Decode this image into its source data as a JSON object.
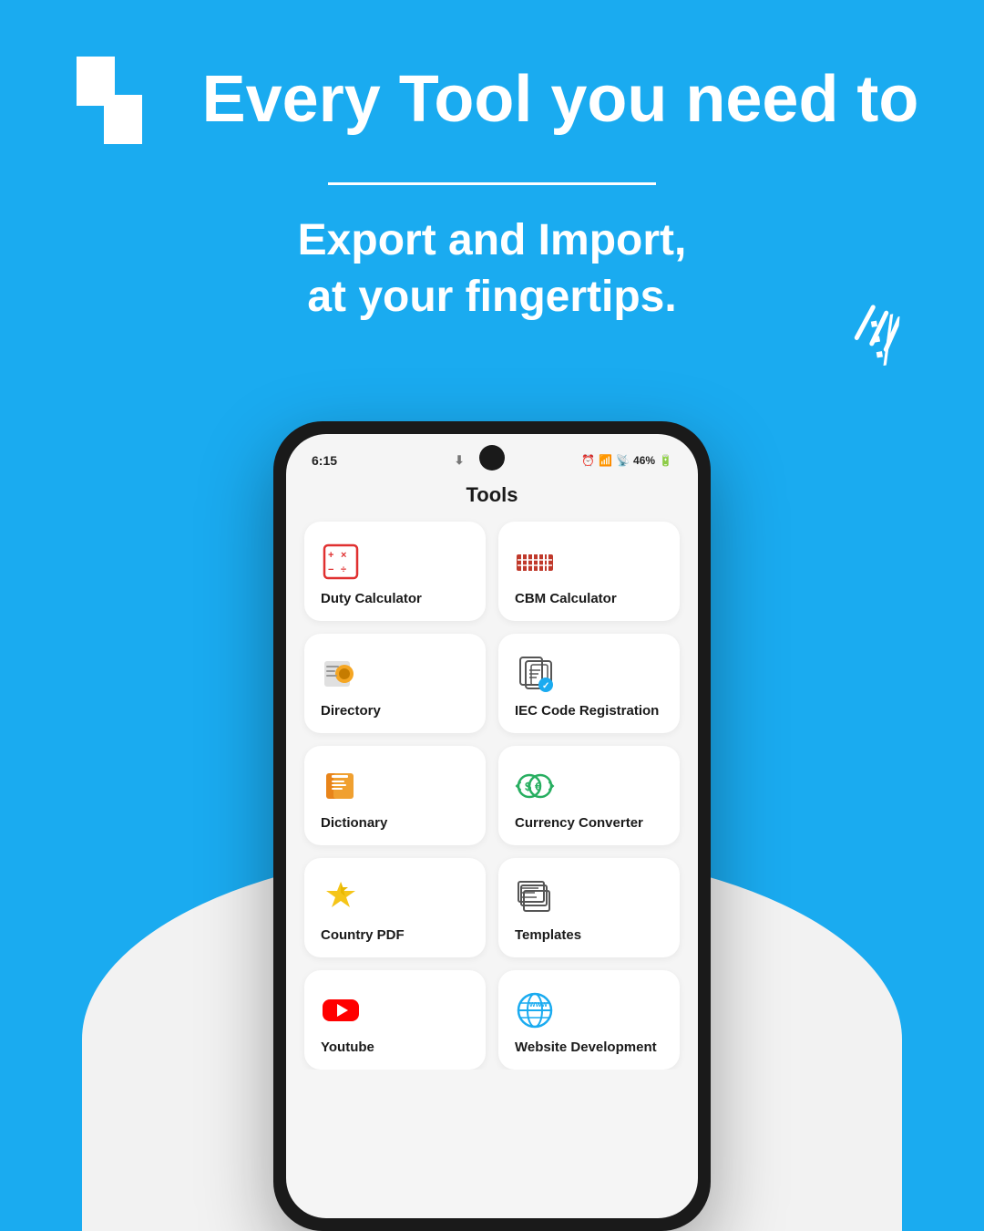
{
  "header": {
    "headline": "Every Tool you need to",
    "subheadline": "Export and Import,\nat your fingertips.",
    "divider": true
  },
  "phone": {
    "status_time": "6:15",
    "status_battery": "46%",
    "screen_title": "Tools",
    "tools": [
      {
        "id": "duty-calculator",
        "name": "Duty Calculator",
        "icon_type": "calc"
      },
      {
        "id": "cbm-calculator",
        "name": "CBM Calculator",
        "icon_type": "barcode"
      },
      {
        "id": "directory",
        "name": "Directory",
        "icon_type": "directory"
      },
      {
        "id": "iec-code",
        "name": "IEC Code Registration",
        "icon_type": "iec"
      },
      {
        "id": "dictionary",
        "name": "Dictionary",
        "icon_type": "dictionary"
      },
      {
        "id": "currency-converter",
        "name": "Currency Converter",
        "icon_type": "currency"
      },
      {
        "id": "country-pdf",
        "name": "Country PDF",
        "icon_type": "stars"
      },
      {
        "id": "templates",
        "name": "Templates",
        "icon_type": "templates"
      },
      {
        "id": "youtube",
        "name": "Youtube",
        "icon_type": "youtube"
      },
      {
        "id": "website-dev",
        "name": "Website Development",
        "icon_type": "www"
      }
    ]
  },
  "colors": {
    "brand_blue": "#1aabf0",
    "white": "#ffffff",
    "card_bg": "#ffffff",
    "screen_bg": "#f5f5f5"
  }
}
